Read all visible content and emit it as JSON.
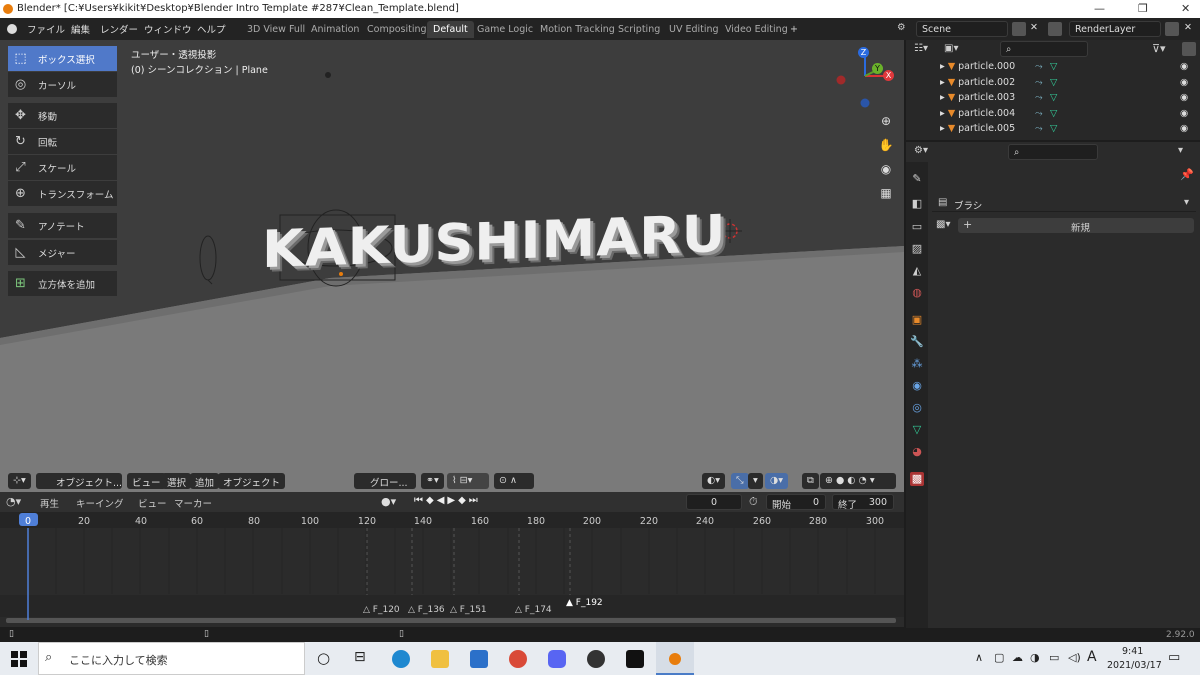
{
  "window": {
    "title": "Blender* [C:¥Users¥kikit¥Desktop¥Blender Intro Template #287¥Clean_Template.blend]"
  },
  "menus": [
    "ファイル",
    "編集",
    "レンダー",
    "ウィンドウ",
    "ヘルプ"
  ],
  "workspaces": [
    "3D View Full",
    "Animation",
    "Compositing",
    "Default",
    "Game Logic",
    "Motion Tracking",
    "Scripting",
    "UV Editing",
    "Video Editing"
  ],
  "scene": {
    "scene_name": "Scene",
    "render_layer": "RenderLayer"
  },
  "viewport": {
    "view_name": "ユーザー・透視投影",
    "collection_info": "(0) シーンコレクション | Plane",
    "text_object": "KAKUSHIMARU",
    "tools": [
      "ボックス選択",
      "カーソル",
      "移動",
      "回転",
      "スケール",
      "トランスフォーム",
      "アノテート",
      "メジャー",
      "立方体を追加"
    ],
    "gizmo": {
      "z": "Z",
      "y": "Y",
      "x": "X"
    },
    "header": {
      "mode": "オブジェクト...",
      "view": "ビュー",
      "select": "選択",
      "add": "追加",
      "object": "オブジェクト",
      "orientation": "グロー..."
    }
  },
  "timeline": {
    "menus": [
      "再生",
      "キーイング",
      "ビュー",
      "マーカー"
    ],
    "current_frame": "0",
    "start_label": "開始",
    "start": "0",
    "end_label": "終了",
    "end": "300",
    "ticks": [
      "0",
      "20",
      "40",
      "60",
      "80",
      "100",
      "120",
      "140",
      "160",
      "180",
      "200",
      "220",
      "240",
      "260",
      "280",
      "300"
    ],
    "markers": [
      "F_120",
      "F_136",
      "F_151",
      "F_174",
      "F_192"
    ]
  },
  "outliner": {
    "items": [
      "particle.000",
      "particle.002",
      "particle.003",
      "particle.004",
      "particle.005"
    ]
  },
  "properties": {
    "panel_title": "ブラシ",
    "new_button": "新規"
  },
  "status": {
    "version": "2.92.0"
  },
  "taskbar": {
    "search_placeholder": "ここに入力して検索",
    "time": "9:41",
    "date": "2021/03/17",
    "ime": "A"
  }
}
